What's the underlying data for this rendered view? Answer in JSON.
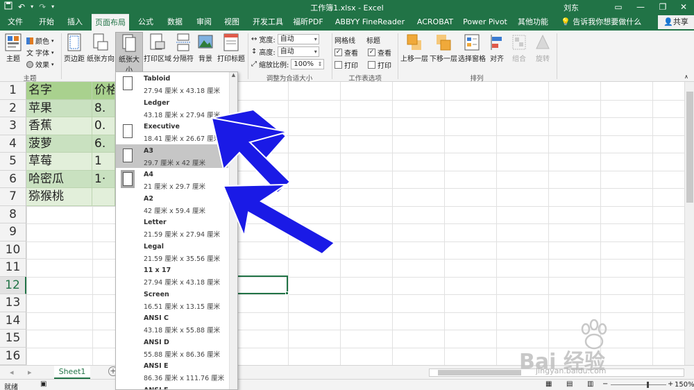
{
  "titlebar": {
    "title": "工作簿1.xlsx  -  Excel",
    "user": "刘东",
    "undo_icon": "undo-icon",
    "redo_icon": "redo-icon"
  },
  "tabs": [
    "文件",
    "开始",
    "插入",
    "页面布局",
    "公式",
    "数据",
    "审阅",
    "视图",
    "开发工具",
    "福昕PDF",
    "ABBYY FineReader 12",
    "ACROBAT",
    "Power Pivot",
    "其他功能"
  ],
  "active_tab": "页面布局",
  "tellme": "告诉我你想要做什么",
  "share": "共享",
  "ribbon": {
    "theme": {
      "label": "主题",
      "colors": "颜色",
      "fonts": "字体",
      "effects": "效果",
      "group": "主题"
    },
    "page_setup": {
      "margins": "页边距",
      "orientation": "纸张方向",
      "size": "纸张大小",
      "print_area": "打印区域",
      "breaks": "分隔符",
      "background": "背景",
      "print_titles": "打印标题"
    },
    "scale": {
      "width_label": "宽度:",
      "width_value": "自动",
      "height_label": "高度:",
      "height_value": "自动",
      "scale_label": "缩放比例:",
      "scale_value": "100%",
      "group": "调整为合适大小"
    },
    "sheet_options": {
      "gridlines": "网格线",
      "headings": "标题",
      "view": "查看",
      "print": "打印",
      "group": "工作表选项"
    },
    "arrange": {
      "bring_forward": "上移一层",
      "send_backward": "下移一层",
      "selection_pane": "选择窗格",
      "align": "对齐",
      "group_btn": "组合",
      "rotate": "旋转",
      "group": "排列"
    }
  },
  "sheet": {
    "rows": [
      "1",
      "2",
      "3",
      "4",
      "5",
      "6",
      "7",
      "8",
      "9",
      "10",
      "11",
      "12",
      "13",
      "14",
      "15",
      "16"
    ],
    "header_name": "名字",
    "header_price": "价格",
    "names": [
      "苹果",
      "香蕉",
      "菠萝",
      "草莓",
      "哈密瓜",
      "猕猴桃"
    ],
    "prices": [
      "8.",
      "0.",
      "6.",
      "1",
      "1·",
      ""
    ]
  },
  "paper_sizes": [
    {
      "name": "Tabloid",
      "dims": "27.94 厘米 x 43.18 厘米"
    },
    {
      "name": "Ledger",
      "dims": "43.18 厘米 x 27.94 厘米"
    },
    {
      "name": "Executive",
      "dims": "18.41 厘米 x 26.67 厘米"
    },
    {
      "name": "A3",
      "dims": "29.7 厘米 x 42 厘米"
    },
    {
      "name": "A4",
      "dims": "21 厘米 x 29.7 厘米"
    },
    {
      "name": "A2",
      "dims": "42 厘米 x 59.4 厘米"
    },
    {
      "name": "Letter",
      "dims": "21.59 厘米 x 27.94 厘米"
    },
    {
      "name": "Legal",
      "dims": "21.59 厘米 x 35.56 厘米"
    },
    {
      "name": "11 x 17",
      "dims": "27.94 厘米 x 43.18 厘米"
    },
    {
      "name": "Screen",
      "dims": "16.51 厘米 x 13.15 厘米"
    },
    {
      "name": "ANSI C",
      "dims": "43.18 厘米 x 55.88 厘米"
    },
    {
      "name": "ANSI D",
      "dims": "55.88 厘米 x 86.36 厘米"
    },
    {
      "name": "ANSI E",
      "dims": "86.36 厘米 x 111.76 厘米"
    },
    {
      "name": "ANSI F",
      "dims": ""
    }
  ],
  "selected_paper": "A4",
  "sheet_tab": "Sheet1",
  "status": {
    "ready": "就绪",
    "zoom": "150%"
  },
  "watermark": {
    "text": "Bai 经验",
    "url": "jingyan.baidu.com"
  },
  "colors": {
    "excel_green": "#217346",
    "arrow_blue": "#1a1ae6",
    "cell_green": "#c9e1c0"
  }
}
